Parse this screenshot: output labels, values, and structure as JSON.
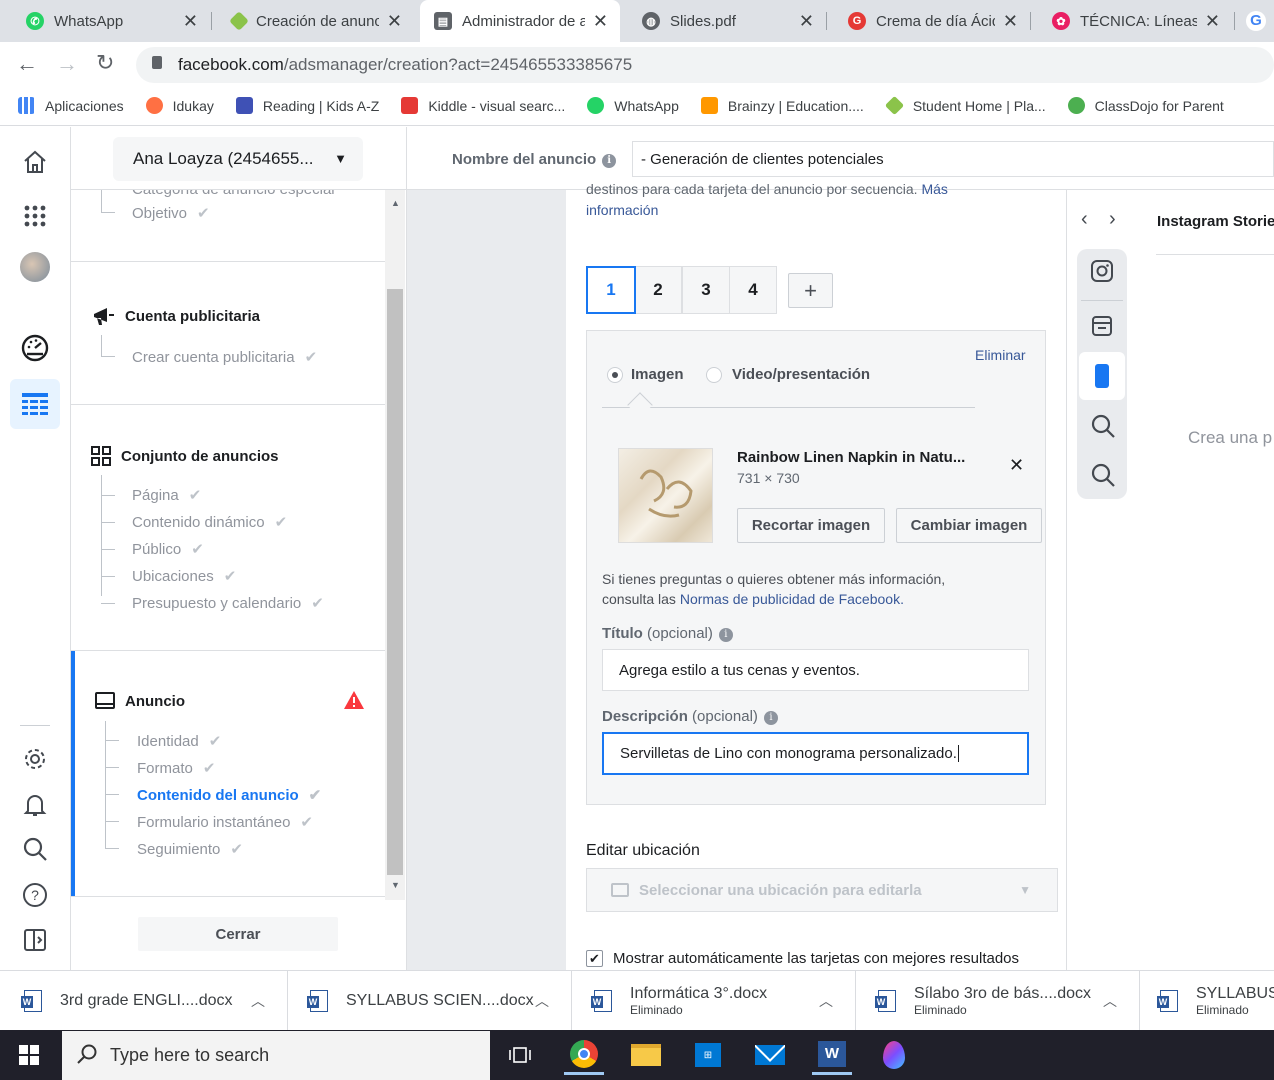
{
  "browser": {
    "tabs": [
      {
        "title": "WhatsApp",
        "icon": "whatsapp-icon",
        "color": "#25d366"
      },
      {
        "title": "Creación de anunc",
        "icon": "diamond-logo-icon",
        "color": "#8bc34a"
      },
      {
        "title": "Administrador de a",
        "icon": "ads-manager-icon",
        "color": "#5f6368",
        "active": true
      },
      {
        "title": "Slides.pdf",
        "icon": "globe-icon",
        "color": "#5f6368"
      },
      {
        "title": "Crema de día Ácid",
        "icon": "g-logo-icon",
        "color": "#e53935"
      },
      {
        "title": "TÉCNICA: Líneas cl",
        "icon": "flower-icon",
        "color": "#e91e63"
      }
    ],
    "url_host": "facebook.com",
    "url_path": "/adsmanager/creation?act=245465533385675",
    "bookmarks": [
      {
        "label": "Aplicaciones",
        "icon": "apps-grid-icon",
        "color": "#4285f4"
      },
      {
        "label": "Idukay",
        "icon": "idukay-icon",
        "color": "#ff7043"
      },
      {
        "label": "Reading | Kids A-Z",
        "icon": "reading-icon",
        "color": "#3f51b5"
      },
      {
        "label": "Kiddle - visual searc...",
        "icon": "kiddle-icon",
        "color": "#e53935"
      },
      {
        "label": "WhatsApp",
        "icon": "whatsapp-icon",
        "color": "#25d366"
      },
      {
        "label": "Brainzy | Education....",
        "icon": "brainzy-icon",
        "color": "#ff9800"
      },
      {
        "label": "Student Home | Pla...",
        "icon": "diamond-logo-icon",
        "color": "#8bc34a"
      },
      {
        "label": "ClassDojo for Parent",
        "icon": "classdojo-icon",
        "color": "#4caf50"
      }
    ]
  },
  "account": {
    "name": "Ana Loayza (2454655..."
  },
  "nav": {
    "cut_text": "Categoría de anuncio especial",
    "objective": "Objetivo",
    "account_section": {
      "title": "Cuenta publicitaria",
      "items": [
        "Crear cuenta publicitaria"
      ]
    },
    "adset_section": {
      "title": "Conjunto de anuncios",
      "items": [
        "Página",
        "Contenido dinámico",
        "Público",
        "Ubicaciones",
        "Presupuesto y calendario"
      ]
    },
    "ad_section": {
      "title": "Anuncio",
      "items": [
        "Identidad",
        "Formato",
        "Contenido del anuncio",
        "Formulario instantáneo",
        "Seguimiento"
      ],
      "active_item": "Contenido del anuncio"
    },
    "close_label": "Cerrar"
  },
  "header": {
    "ad_name_label": "Nombre del anuncio",
    "ad_name_value": "- Generación de clientes potenciales"
  },
  "editor": {
    "top_text_cut": "destinos para cada tarjeta del anuncio por secuencia.",
    "mas": "Más",
    "informacion": "información",
    "cards": [
      "1",
      "2",
      "3",
      "4"
    ],
    "add_card": "+",
    "eliminar": "Eliminar",
    "media_options": [
      "Imagen",
      "Video/presentación"
    ],
    "image": {
      "name": "Rainbow Linen Napkin in Natu...",
      "dims": "731 × 730"
    },
    "crop_button": "Recortar imagen",
    "change_button": "Cambiar imagen",
    "help_text_1": "Si tienes preguntas o quieres obtener más información,",
    "help_text_2": "consulta las",
    "help_link": "Normas de publicidad de Facebook.",
    "title_label": "Título",
    "optional": "(opcional)",
    "title_value": "Agrega estilo a tus cenas y eventos.",
    "desc_label": "Descripción",
    "desc_value": "Servilletas de Lino con monograma personalizado.",
    "edit_placement": "Editar ubicación",
    "placement_select": "Seleccionar una ubicación para editarla",
    "auto_cards": "Mostrar automáticamente las tarjetas con mejores resultados"
  },
  "preview": {
    "title": "Instagram Storie",
    "empty": "Crea una p"
  },
  "downloads": [
    {
      "name": "3rd grade ENGLI....docx",
      "sub": ""
    },
    {
      "name": "SYLLABUS SCIEN....docx",
      "sub": ""
    },
    {
      "name": "Informática 3°.docx",
      "sub": "Eliminado"
    },
    {
      "name": "Sílabo 3ro de bás....docx",
      "sub": "Eliminado"
    },
    {
      "name": "SYLLABUS.",
      "sub": "Eliminado"
    }
  ],
  "taskbar": {
    "search_placeholder": "Type here to search"
  },
  "colors": {
    "fb_blue": "#1877f2",
    "link": "#385898",
    "warning": "#fa383e",
    "taskbar": "#20202a"
  }
}
